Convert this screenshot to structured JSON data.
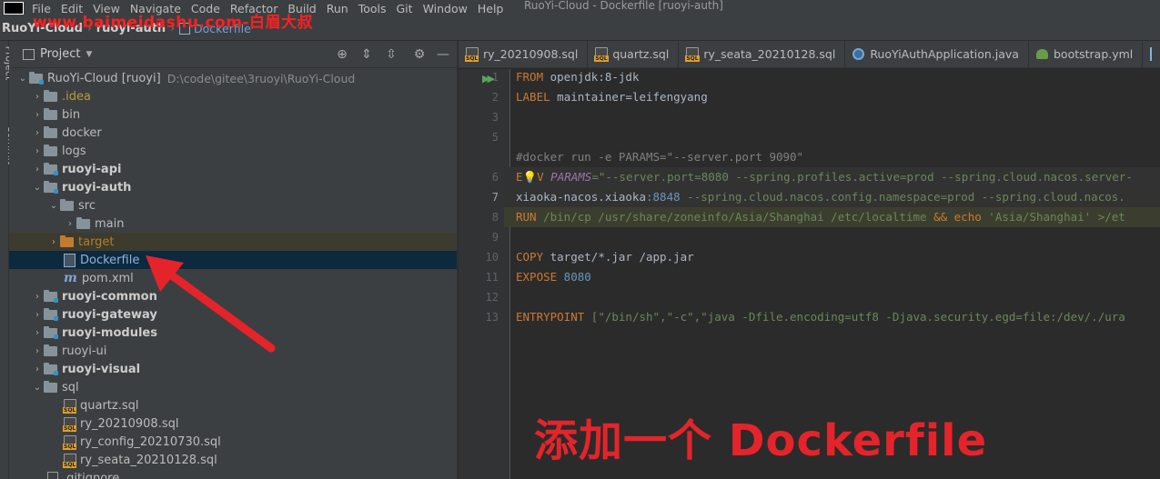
{
  "watermark": "www.baimeidashu.com-白眉大叔",
  "menu": {
    "items": [
      "File",
      "Edit",
      "View",
      "Navigate",
      "Code",
      "Refactor",
      "Build",
      "Run",
      "Tools",
      "Git",
      "Window",
      "Help"
    ],
    "window_title": "RuoYi-Cloud - Dockerfile [ruoyi-auth]"
  },
  "breadcrumb": {
    "project": "RuoYi-Cloud",
    "module": "ruoyi-auth",
    "file": "Dockerfile"
  },
  "left_strip": {
    "project_label": "Project",
    "commit_label": "Commit"
  },
  "project_panel": {
    "title": "Project",
    "header_icons": [
      "crosshair-icon",
      "collapse-icon",
      "expand-icon",
      "gear-icon",
      "minimize-icon"
    ]
  },
  "tree": {
    "root_name": "RuoYi-Cloud [ruoyi]",
    "root_path": "D:\\code\\gitee\\3ruoyi\\RuoYi-Cloud",
    "idea": ".idea",
    "bin": "bin",
    "docker": "docker",
    "logs": "logs",
    "ruoyi_api": "ruoyi-api",
    "ruoyi_auth": "ruoyi-auth",
    "src": "src",
    "main": "main",
    "target": "target",
    "dockerfile": "Dockerfile",
    "pom": "pom.xml",
    "ruoyi_common": "ruoyi-common",
    "ruoyi_gateway": "ruoyi-gateway",
    "ruoyi_modules": "ruoyi-modules",
    "ruoyi_ui": "ruoyi-ui",
    "ruoyi_visual": "ruoyi-visual",
    "sql": "sql",
    "quartz_sql": "quartz.sql",
    "ry_20210908_sql": "ry_20210908.sql",
    "ry_config_sql": "ry_config_20210730.sql",
    "ry_seata_sql": "ry_seata_20210128.sql",
    "gitignore": ".gitignore"
  },
  "tabs": [
    "ry_20210908.sql",
    "quartz.sql",
    "ry_seata_20210128.sql",
    "RuoYiAuthApplication.java",
    "bootstrap.yml"
  ],
  "line_numbers": [
    "1",
    "2",
    "3",
    "5",
    "6",
    "7",
    "8",
    "9",
    "10",
    "11",
    "12",
    "13"
  ],
  "code": {
    "l1_kw": "FROM",
    "l1_rest": " openjdk:8-jdk",
    "l2_kw": "LABEL",
    "l2_rest": " maintainer=leifengyang",
    "l5": "#docker run -e PARAMS=\"--server.port 9090\"",
    "l6_kw_a": "E",
    "l6_kw_b": "V",
    "l6_param": "PARAMS",
    "l6_str": "=\"--server.port=8080 --spring.profiles.active=prod --spring.cloud.nacos.server-",
    "l7_a": "xiaoka-nacos.xiaoka",
    "l7_num": ":8848",
    "l7_str": " --spring.cloud.nacos.config.namespace=prod --spring.cloud.nacos.",
    "l8_kw": "RUN",
    "l8_cmd": " /bin/cp /usr/share/zoneinfo/Asia/Shanghai /etc/localtime",
    "l8_op": " && ",
    "l8_echo": "echo",
    "l8_str": " 'Asia/Shanghai'",
    "l8_tail": " >/et",
    "l10_kw": "COPY",
    "l10_rest": " target/*.jar /app.jar",
    "l11_kw": "EXPOSE",
    "l11_num": " 8080",
    "l13_kw": "ENTRYPOINT",
    "l13_rest": " [\"/bin/sh\",\"-c\",\"java -Dfile.encoding=utf8 -Djava.security.egd=file:/dev/./ura"
  },
  "annotation": "添加一个 Dockerfile",
  "colors": {
    "annotation_red": "#e4242a",
    "selection": "#0d293e",
    "keyword": "#cc7832",
    "string": "#6a8759",
    "number": "#6897bb"
  }
}
